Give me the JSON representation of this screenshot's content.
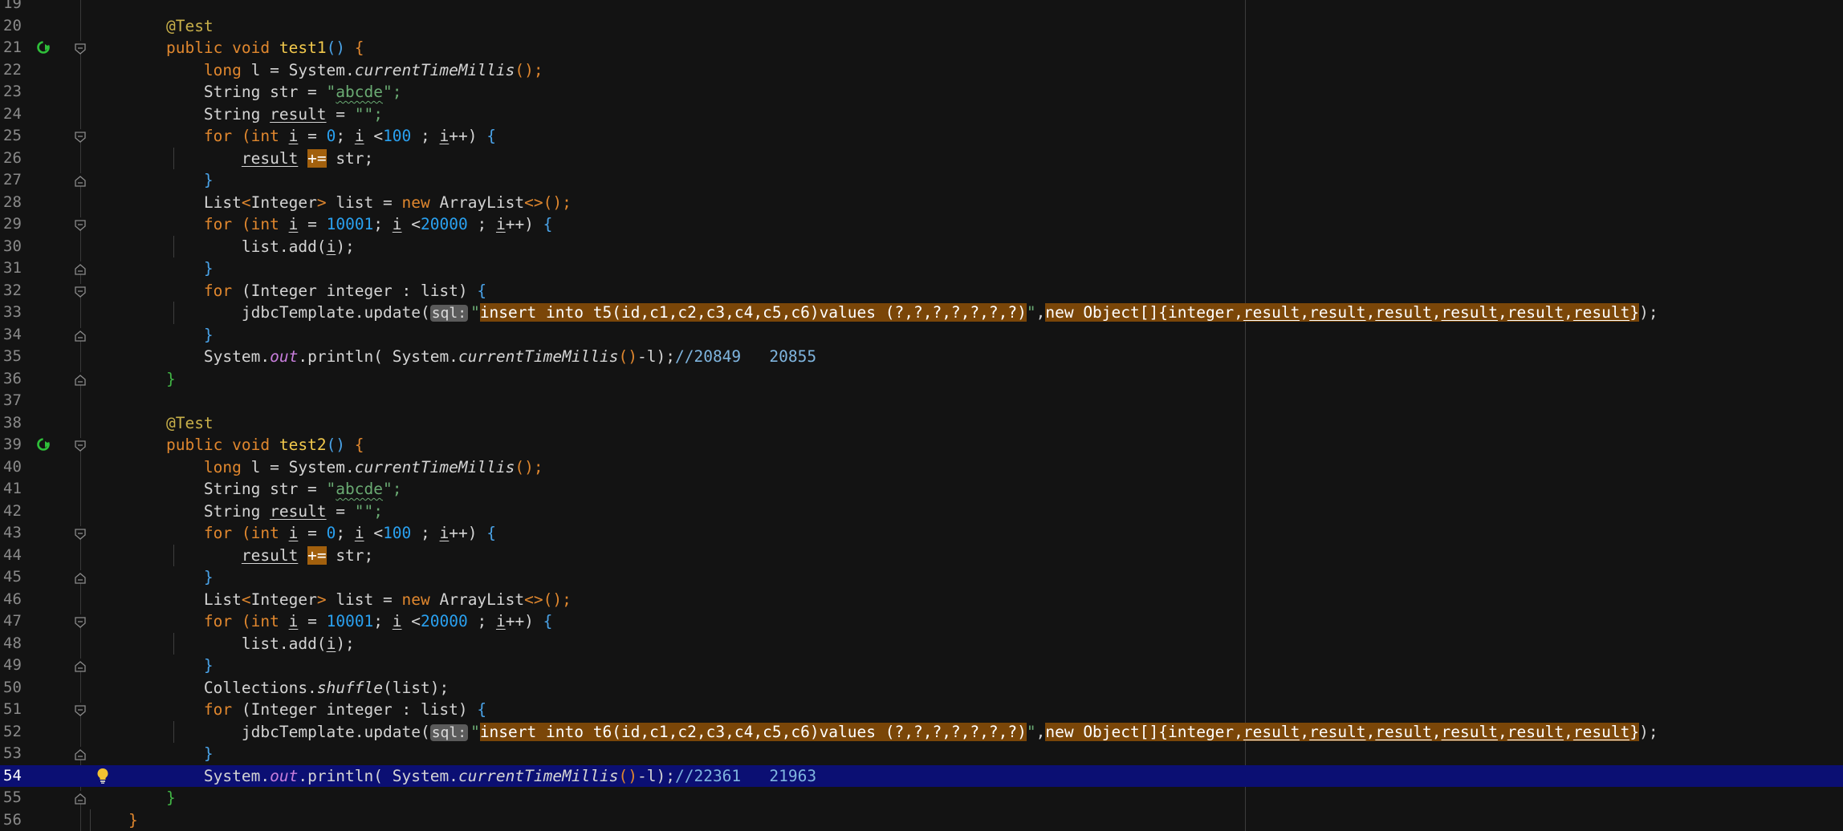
{
  "editor": {
    "bulb_icon": "lightbulb-icon",
    "run_icon": "run-test-icon",
    "fold_icon": "fold-marker-icon",
    "sql_label": "sql:"
  },
  "colors": {
    "background": "#131313",
    "current_line": "#0b0f73",
    "keyword": "#e0872e",
    "string": "#6aab73",
    "number": "#2aa1f0",
    "highlight": "#7a4608"
  },
  "lines": [
    {
      "n": "19",
      "segs": []
    },
    {
      "n": "20",
      "segs": [
        [
          "    ",
          ""
        ],
        [
          "@Test",
          "ann"
        ]
      ]
    },
    {
      "n": "21",
      "segs": [
        [
          "    ",
          ""
        ],
        [
          "public void ",
          "kw"
        ],
        [
          "test1",
          "mth"
        ],
        [
          "() ",
          "blu"
        ],
        [
          "{",
          "kw"
        ]
      ]
    },
    {
      "n": "22",
      "segs": [
        [
          "        ",
          ""
        ],
        [
          "long ",
          "kw"
        ],
        [
          "l = System.",
          ""
        ],
        [
          "currentTimeMillis",
          "ital"
        ],
        [
          "();",
          "kw"
        ]
      ]
    },
    {
      "n": "23",
      "segs": [
        [
          "        ",
          ""
        ],
        [
          "String str = ",
          ""
        ],
        [
          "\"",
          "str"
        ],
        [
          "abcde",
          "str squig"
        ],
        [
          "\";",
          "str"
        ]
      ]
    },
    {
      "n": "24",
      "segs": [
        [
          "        ",
          ""
        ],
        [
          "String ",
          ""
        ],
        [
          "result",
          "ul"
        ],
        [
          " = ",
          ""
        ],
        [
          "\"\";",
          "str"
        ]
      ]
    },
    {
      "n": "25",
      "segs": [
        [
          "        ",
          ""
        ],
        [
          "for ",
          "kw"
        ],
        [
          "(",
          "kw"
        ],
        [
          "int ",
          "kw"
        ],
        [
          "i",
          "ul"
        ],
        [
          " = ",
          ""
        ],
        [
          "0",
          "num"
        ],
        [
          "; ",
          ""
        ],
        [
          "i",
          "ul"
        ],
        [
          " <",
          ""
        ],
        [
          "100",
          "num"
        ],
        [
          " ; ",
          ""
        ],
        [
          "i",
          "ul"
        ],
        [
          "++) ",
          ""
        ],
        [
          "{",
          "blu"
        ]
      ]
    },
    {
      "n": "26",
      "segs": [
        [
          "            ",
          ""
        ],
        [
          "result",
          "ul"
        ],
        [
          " ",
          ""
        ],
        [
          "+=",
          "hlop"
        ],
        [
          " str;",
          ""
        ]
      ]
    },
    {
      "n": "27",
      "segs": [
        [
          "        ",
          ""
        ],
        [
          "}",
          "blu"
        ]
      ]
    },
    {
      "n": "28",
      "segs": [
        [
          "        ",
          ""
        ],
        [
          "List",
          ""
        ],
        [
          "<",
          "kw"
        ],
        [
          "Integer",
          ""
        ],
        [
          "> ",
          "kw"
        ],
        [
          "list = ",
          ""
        ],
        [
          "new ",
          "kw"
        ],
        [
          "ArrayList",
          ""
        ],
        [
          "<>();",
          "kw"
        ]
      ]
    },
    {
      "n": "29",
      "segs": [
        [
          "        ",
          ""
        ],
        [
          "for ",
          "kw"
        ],
        [
          "(",
          "kw"
        ],
        [
          "int ",
          "kw"
        ],
        [
          "i",
          "ul"
        ],
        [
          " = ",
          ""
        ],
        [
          "10001",
          "num"
        ],
        [
          "; ",
          ""
        ],
        [
          "i",
          "ul"
        ],
        [
          " <",
          ""
        ],
        [
          "20000",
          "num"
        ],
        [
          " ; ",
          ""
        ],
        [
          "i",
          "ul"
        ],
        [
          "++) ",
          ""
        ],
        [
          "{",
          "blu"
        ]
      ]
    },
    {
      "n": "30",
      "segs": [
        [
          "            ",
          ""
        ],
        [
          "list.add(",
          ""
        ],
        [
          "i",
          "ul"
        ],
        [
          ");",
          ""
        ]
      ]
    },
    {
      "n": "31",
      "segs": [
        [
          "        ",
          ""
        ],
        [
          "}",
          "blu"
        ]
      ]
    },
    {
      "n": "32",
      "segs": [
        [
          "        ",
          ""
        ],
        [
          "for ",
          "kw"
        ],
        [
          "(Integer integer : list) ",
          ""
        ],
        [
          "{",
          "blu"
        ]
      ]
    },
    {
      "n": "33",
      "segs": [
        [
          "            ",
          ""
        ],
        [
          "jdbcTemplate.update(",
          ""
        ],
        [
          "sql:",
          "sqltag"
        ],
        [
          "\"",
          "str"
        ],
        [
          "insert into ",
          "hl"
        ],
        [
          "t5",
          "hl red"
        ],
        [
          "(",
          "hl"
        ],
        [
          "id",
          "hl red"
        ],
        [
          ",",
          "hl"
        ],
        [
          "c1",
          "hl red"
        ],
        [
          ",",
          "hl"
        ],
        [
          "c2",
          "hl red"
        ],
        [
          ",",
          "hl"
        ],
        [
          "c3",
          "hl red"
        ],
        [
          ",",
          "hl"
        ],
        [
          "c4",
          "hl red"
        ],
        [
          ",",
          "hl"
        ],
        [
          "c5",
          "hl red"
        ],
        [
          ",",
          "hl"
        ],
        [
          "c6",
          "hl red"
        ],
        [
          ")values (?,?,?,?,?,?,?)",
          "hl"
        ],
        [
          "\"",
          "str"
        ],
        [
          ",",
          ""
        ],
        [
          "new Object[]{integer,",
          "hl"
        ],
        [
          "result",
          "hl ul"
        ],
        [
          ",",
          "hl"
        ],
        [
          "result",
          "hl ul"
        ],
        [
          ",",
          "hl"
        ],
        [
          "result",
          "hl ul"
        ],
        [
          ",",
          "hl"
        ],
        [
          "result",
          "hl ul"
        ],
        [
          ",",
          "hl"
        ],
        [
          "result",
          "hl ul"
        ],
        [
          ",",
          "hl"
        ],
        [
          "result",
          "hl ul"
        ],
        [
          "}",
          "hl"
        ],
        [
          ");",
          ""
        ]
      ]
    },
    {
      "n": "34",
      "segs": [
        [
          "        ",
          ""
        ],
        [
          "}",
          "blu"
        ]
      ]
    },
    {
      "n": "35",
      "segs": [
        [
          "        ",
          ""
        ],
        [
          "System.",
          ""
        ],
        [
          "out",
          "field"
        ],
        [
          ".println( System.",
          ""
        ],
        [
          "currentTimeMillis",
          "ital"
        ],
        [
          "()",
          "kw"
        ],
        [
          "-l);",
          ""
        ],
        [
          "//20849   20855",
          "cmt"
        ]
      ]
    },
    {
      "n": "36",
      "segs": [
        [
          "    ",
          ""
        ],
        [
          "}",
          "grn"
        ]
      ]
    },
    {
      "n": "37",
      "segs": []
    },
    {
      "n": "38",
      "segs": [
        [
          "    ",
          ""
        ],
        [
          "@Test",
          "ann"
        ]
      ]
    },
    {
      "n": "39",
      "segs": [
        [
          "    ",
          ""
        ],
        [
          "public void ",
          "kw"
        ],
        [
          "test2",
          "mth"
        ],
        [
          "() ",
          "blu"
        ],
        [
          "{",
          "kw"
        ]
      ]
    },
    {
      "n": "40",
      "segs": [
        [
          "        ",
          ""
        ],
        [
          "long ",
          "kw"
        ],
        [
          "l = System.",
          ""
        ],
        [
          "currentTimeMillis",
          "ital"
        ],
        [
          "();",
          "kw"
        ]
      ]
    },
    {
      "n": "41",
      "segs": [
        [
          "        ",
          ""
        ],
        [
          "String str = ",
          ""
        ],
        [
          "\"",
          "str"
        ],
        [
          "abcde",
          "str squig"
        ],
        [
          "\";",
          "str"
        ]
      ]
    },
    {
      "n": "42",
      "segs": [
        [
          "        ",
          ""
        ],
        [
          "String ",
          ""
        ],
        [
          "result",
          "ul"
        ],
        [
          " = ",
          ""
        ],
        [
          "\"\";",
          "str"
        ]
      ]
    },
    {
      "n": "43",
      "segs": [
        [
          "        ",
          ""
        ],
        [
          "for ",
          "kw"
        ],
        [
          "(",
          "kw"
        ],
        [
          "int ",
          "kw"
        ],
        [
          "i",
          "ul"
        ],
        [
          " = ",
          ""
        ],
        [
          "0",
          "num"
        ],
        [
          "; ",
          ""
        ],
        [
          "i",
          "ul"
        ],
        [
          " <",
          ""
        ],
        [
          "100",
          "num"
        ],
        [
          " ; ",
          ""
        ],
        [
          "i",
          "ul"
        ],
        [
          "++) ",
          ""
        ],
        [
          "{",
          "blu"
        ]
      ]
    },
    {
      "n": "44",
      "segs": [
        [
          "            ",
          ""
        ],
        [
          "result",
          "ul"
        ],
        [
          " ",
          ""
        ],
        [
          "+=",
          "hlop"
        ],
        [
          " str;",
          ""
        ]
      ]
    },
    {
      "n": "45",
      "segs": [
        [
          "        ",
          ""
        ],
        [
          "}",
          "blu"
        ]
      ]
    },
    {
      "n": "46",
      "segs": [
        [
          "        ",
          ""
        ],
        [
          "List",
          ""
        ],
        [
          "<",
          "kw"
        ],
        [
          "Integer",
          ""
        ],
        [
          "> ",
          "kw"
        ],
        [
          "list = ",
          ""
        ],
        [
          "new ",
          "kw"
        ],
        [
          "ArrayList",
          ""
        ],
        [
          "<>();",
          "kw"
        ]
      ]
    },
    {
      "n": "47",
      "segs": [
        [
          "        ",
          ""
        ],
        [
          "for ",
          "kw"
        ],
        [
          "(",
          "kw"
        ],
        [
          "int ",
          "kw"
        ],
        [
          "i",
          "ul"
        ],
        [
          " = ",
          ""
        ],
        [
          "10001",
          "num"
        ],
        [
          "; ",
          ""
        ],
        [
          "i",
          "ul"
        ],
        [
          " <",
          ""
        ],
        [
          "20000",
          "num"
        ],
        [
          " ; ",
          ""
        ],
        [
          "i",
          "ul"
        ],
        [
          "++) ",
          ""
        ],
        [
          "{",
          "blu"
        ]
      ]
    },
    {
      "n": "48",
      "segs": [
        [
          "            ",
          ""
        ],
        [
          "list.add(",
          ""
        ],
        [
          "i",
          "ul"
        ],
        [
          ");",
          ""
        ]
      ]
    },
    {
      "n": "49",
      "segs": [
        [
          "        ",
          ""
        ],
        [
          "}",
          "blu"
        ]
      ]
    },
    {
      "n": "50",
      "segs": [
        [
          "        ",
          ""
        ],
        [
          "Collections.",
          ""
        ],
        [
          "shuffle",
          "ital"
        ],
        [
          "(list);",
          ""
        ]
      ]
    },
    {
      "n": "51",
      "segs": [
        [
          "        ",
          ""
        ],
        [
          "for ",
          "kw"
        ],
        [
          "(Integer integer : list) ",
          ""
        ],
        [
          "{",
          "blu"
        ]
      ]
    },
    {
      "n": "52",
      "segs": [
        [
          "            ",
          ""
        ],
        [
          "jdbcTemplate.update(",
          ""
        ],
        [
          "sql:",
          "sqltag"
        ],
        [
          "\"",
          "str"
        ],
        [
          "insert into ",
          "hl"
        ],
        [
          "t6",
          "hl red"
        ],
        [
          "(",
          "hl"
        ],
        [
          "id",
          "hl red"
        ],
        [
          ",",
          "hl"
        ],
        [
          "c1",
          "hl red"
        ],
        [
          ",",
          "hl"
        ],
        [
          "c2",
          "hl red"
        ],
        [
          ",",
          "hl"
        ],
        [
          "c3",
          "hl red"
        ],
        [
          ",",
          "hl"
        ],
        [
          "c4",
          "hl red"
        ],
        [
          ",",
          "hl"
        ],
        [
          "c5",
          "hl red"
        ],
        [
          ",",
          "hl"
        ],
        [
          "c6",
          "hl red"
        ],
        [
          ")values (?,?,?,?,?,?,?)",
          "hl"
        ],
        [
          "\"",
          "str"
        ],
        [
          ",",
          ""
        ],
        [
          "new Object[]{integer,",
          "hl"
        ],
        [
          "result",
          "hl ul"
        ],
        [
          ",",
          "hl"
        ],
        [
          "result",
          "hl ul"
        ],
        [
          ",",
          "hl"
        ],
        [
          "result",
          "hl ul"
        ],
        [
          ",",
          "hl"
        ],
        [
          "result",
          "hl ul"
        ],
        [
          ",",
          "hl"
        ],
        [
          "result",
          "hl ul"
        ],
        [
          ",",
          "hl"
        ],
        [
          "result",
          "hl ul"
        ],
        [
          "}",
          "hl"
        ],
        [
          ");",
          ""
        ]
      ]
    },
    {
      "n": "53",
      "segs": [
        [
          "        ",
          ""
        ],
        [
          "}",
          "blu"
        ]
      ]
    },
    {
      "n": "54",
      "segs": [
        [
          "        ",
          ""
        ],
        [
          "System.",
          ""
        ],
        [
          "out",
          "field"
        ],
        [
          ".println( System.",
          ""
        ],
        [
          "currentTimeMillis",
          "ital"
        ],
        [
          "()",
          "kw"
        ],
        [
          "-l);",
          ""
        ],
        [
          "//22361   21963",
          "cmt"
        ]
      ]
    },
    {
      "n": "55",
      "segs": [
        [
          "    ",
          ""
        ],
        [
          "}",
          "grn"
        ]
      ]
    },
    {
      "n": "56",
      "segs": [
        [
          "}",
          "kw"
        ]
      ]
    }
  ],
  "current_line": "54",
  "run_lines": [
    "21",
    "39"
  ],
  "bulb_line": "54",
  "fold_lines": [
    "21",
    "25",
    "27",
    "29",
    "31",
    "32",
    "34",
    "36",
    "39",
    "43",
    "45",
    "47",
    "49",
    "51",
    "53",
    "55"
  ]
}
